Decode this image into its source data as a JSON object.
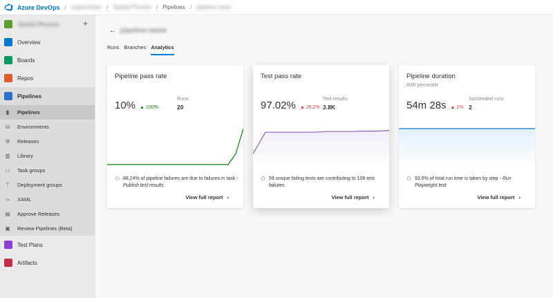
{
  "topbar": {
    "brand": "Azure DevOps",
    "crumb_org": "organization",
    "crumb_project": "Spatial Phoenix",
    "crumb_section": "Pipelines",
    "crumb_pipeline": "pipeline-name"
  },
  "sidebar": {
    "project_name": "Spatial Phoenix",
    "add_label": "+",
    "items": [
      {
        "label": "Overview",
        "icon": "overview-icon",
        "color": "#0078d4"
      },
      {
        "label": "Boards",
        "icon": "boards-icon",
        "color": "#009a62"
      },
      {
        "label": "Repos",
        "icon": "repos-icon",
        "color": "#e05a2a"
      },
      {
        "label": "Pipelines",
        "icon": "pipelines-icon",
        "color": "#2f6fd0"
      }
    ],
    "pipeline_subitems": [
      {
        "label": "Pipelines",
        "icon": "pipelines-sub-icon",
        "glyph": "▮"
      },
      {
        "label": "Environments",
        "icon": "environments-icon",
        "glyph": "⛁"
      },
      {
        "label": "Releases",
        "icon": "releases-icon",
        "glyph": "⚙"
      },
      {
        "label": "Library",
        "icon": "library-icon",
        "glyph": "▥"
      },
      {
        "label": "Task groups",
        "icon": "task-groups-icon",
        "glyph": "▭"
      },
      {
        "label": "Deployment groups",
        "icon": "deployment-groups-icon",
        "glyph": "⊤"
      },
      {
        "label": "XAML",
        "icon": "xaml-icon",
        "glyph": "‹›"
      },
      {
        "label": "Approve Releases",
        "icon": "approve-releases-icon",
        "glyph": "▤"
      },
      {
        "label": "Review Pipelines (Beta)",
        "icon": "review-pipelines-icon",
        "glyph": "▣"
      }
    ],
    "bottom_items": [
      {
        "label": "Test Plans",
        "icon": "test-plans-icon",
        "color": "#8a3ed6"
      },
      {
        "label": "Artifacts",
        "icon": "artifacts-icon",
        "color": "#c1304a"
      }
    ]
  },
  "page": {
    "back_icon": "←",
    "title": "pipeline-name",
    "tabs": [
      "Runs",
      "Branches",
      "Analytics"
    ],
    "active_tab": "Analytics"
  },
  "cards": [
    {
      "title": "Pipeline pass rate",
      "subtitle": "",
      "value": "10%",
      "delta": "▲ 100%",
      "delta_dir": "up",
      "stat_label": "Runs:",
      "stat_value": "20",
      "footer": "88.24% of pipeline failures are due to failures in task - ",
      "footer_em": "Publish test results",
      "link": "View full report",
      "line_color": "#107c10",
      "series": [
        0,
        0,
        0,
        0,
        0,
        0,
        0,
        0,
        0,
        0,
        0,
        0,
        0,
        0,
        0,
        0,
        0,
        0.3,
        1
      ]
    },
    {
      "title": "Test pass rate",
      "subtitle": "",
      "value": "97.02%",
      "delta": "▲ 26.2%",
      "delta_dir": "down",
      "stat_label": "Test results:",
      "stat_value": "3.8K",
      "footer": "59 unique failing tests are contributing to 108 test failures",
      "footer_em": "",
      "link": "View full report",
      "line_color": "#8764b8",
      "series": [
        0.3,
        0.9,
        0.9,
        0.9,
        0.9,
        0.9,
        0.92,
        0.92,
        0.92,
        0.93,
        0.93,
        0.95
      ]
    },
    {
      "title": "Pipeline duration",
      "subtitle": "80th percentile",
      "value": "54m 28s",
      "delta": "▲ 1%",
      "delta_dir": "down",
      "stat_label": "Succeeded runs:",
      "stat_value": "2",
      "footer": "93.6% of total run time is taken by step - ",
      "footer_em": "Run Playwright test",
      "link": "View full report",
      "line_color": "#0078d4",
      "series": [
        1,
        1
      ]
    }
  ]
}
